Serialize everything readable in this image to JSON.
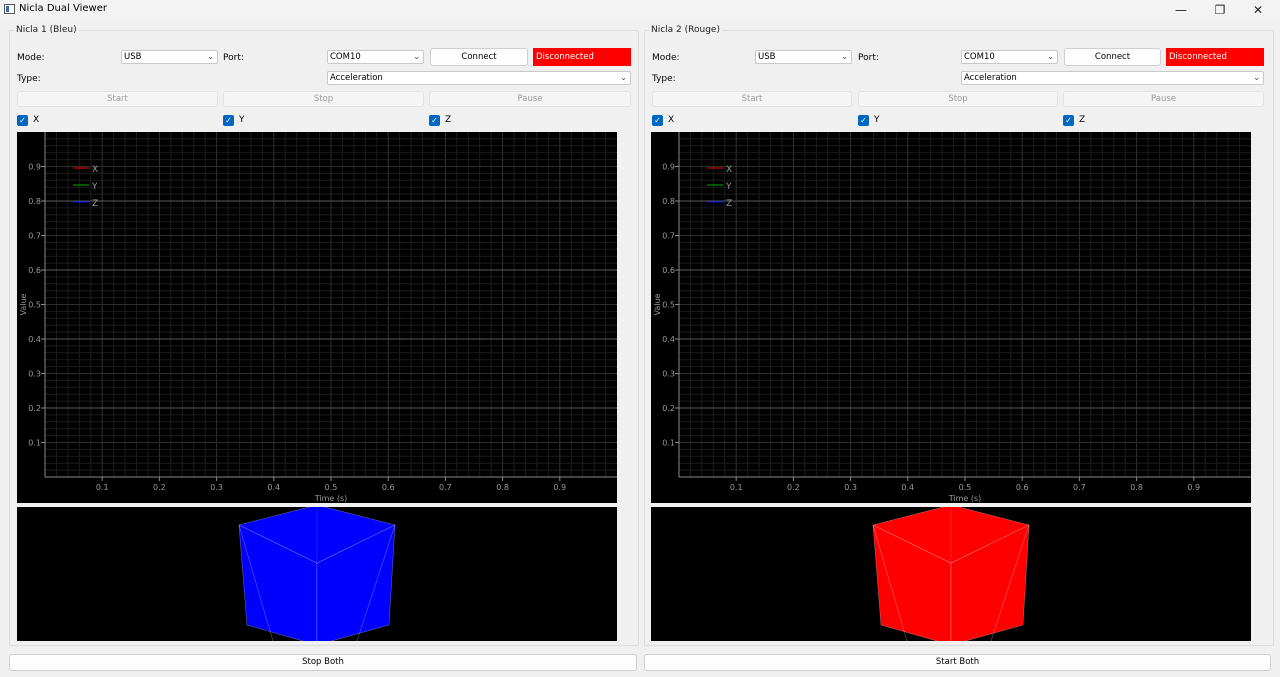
{
  "window": {
    "title": "Nicla Dual Viewer",
    "minimize": "—",
    "maximize": "❐",
    "close": "✕"
  },
  "panels": [
    {
      "title": "Nicla 1 (Bleu)",
      "mode_label": "Mode:",
      "mode_value": "USB",
      "port_label": "Port:",
      "port_value": "COM10",
      "connect_label": "Connect",
      "status_text": "Disconnected",
      "status_color": "#ff0000",
      "type_label": "Type:",
      "type_value": "Acceleration",
      "start_label": "Start",
      "stop_label": "Stop",
      "pause_label": "Pause",
      "checks": [
        {
          "label": "X",
          "checked": true
        },
        {
          "label": "Y",
          "checked": true
        },
        {
          "label": "Z",
          "checked": true
        }
      ],
      "cube_color": "#0000ff"
    },
    {
      "title": "Nicla 2 (Rouge)",
      "mode_label": "Mode:",
      "mode_value": "USB",
      "port_label": "Port:",
      "port_value": "COM10",
      "connect_label": "Connect",
      "status_text": "Disconnected",
      "status_color": "#ff0000",
      "type_label": "Type:",
      "type_value": "Acceleration",
      "start_label": "Start",
      "stop_label": "Stop",
      "pause_label": "Pause",
      "checks": [
        {
          "label": "X",
          "checked": true
        },
        {
          "label": "Y",
          "checked": true
        },
        {
          "label": "Z",
          "checked": true
        }
      ],
      "cube_color": "#ff0000"
    }
  ],
  "chart_data": [
    {
      "type": "line",
      "xlabel": "Time (s)",
      "ylabel": "Value",
      "xlim": [
        0,
        1
      ],
      "ylim": [
        0,
        1
      ],
      "xticks": [
        "0.1",
        "0.2",
        "0.3",
        "0.4",
        "0.5",
        "0.6",
        "0.7",
        "0.8",
        "0.9"
      ],
      "yticks": [
        "0.1",
        "0.2",
        "0.3",
        "0.4",
        "0.5",
        "0.6",
        "0.7",
        "0.8",
        "0.9"
      ],
      "grid": true,
      "legend": "top-left",
      "series": [
        {
          "name": "X",
          "color": "#ff0000",
          "values": []
        },
        {
          "name": "Y",
          "color": "#00aa00",
          "values": []
        },
        {
          "name": "Z",
          "color": "#0000ff",
          "values": []
        }
      ]
    },
    {
      "type": "line",
      "xlabel": "Time (s)",
      "ylabel": "Value",
      "xlim": [
        0,
        1
      ],
      "ylim": [
        0,
        1
      ],
      "xticks": [
        "0.1",
        "0.2",
        "0.3",
        "0.4",
        "0.5",
        "0.6",
        "0.7",
        "0.8",
        "0.9"
      ],
      "yticks": [
        "0.1",
        "0.2",
        "0.3",
        "0.4",
        "0.5",
        "0.6",
        "0.7",
        "0.8",
        "0.9"
      ],
      "grid": true,
      "legend": "top-left",
      "series": [
        {
          "name": "X",
          "color": "#ff0000",
          "values": []
        },
        {
          "name": "Y",
          "color": "#00aa00",
          "values": []
        },
        {
          "name": "Z",
          "color": "#0000ff",
          "values": []
        }
      ]
    }
  ],
  "footer": {
    "stop_both_label": "Stop Both",
    "start_both_label": "Start Both"
  }
}
